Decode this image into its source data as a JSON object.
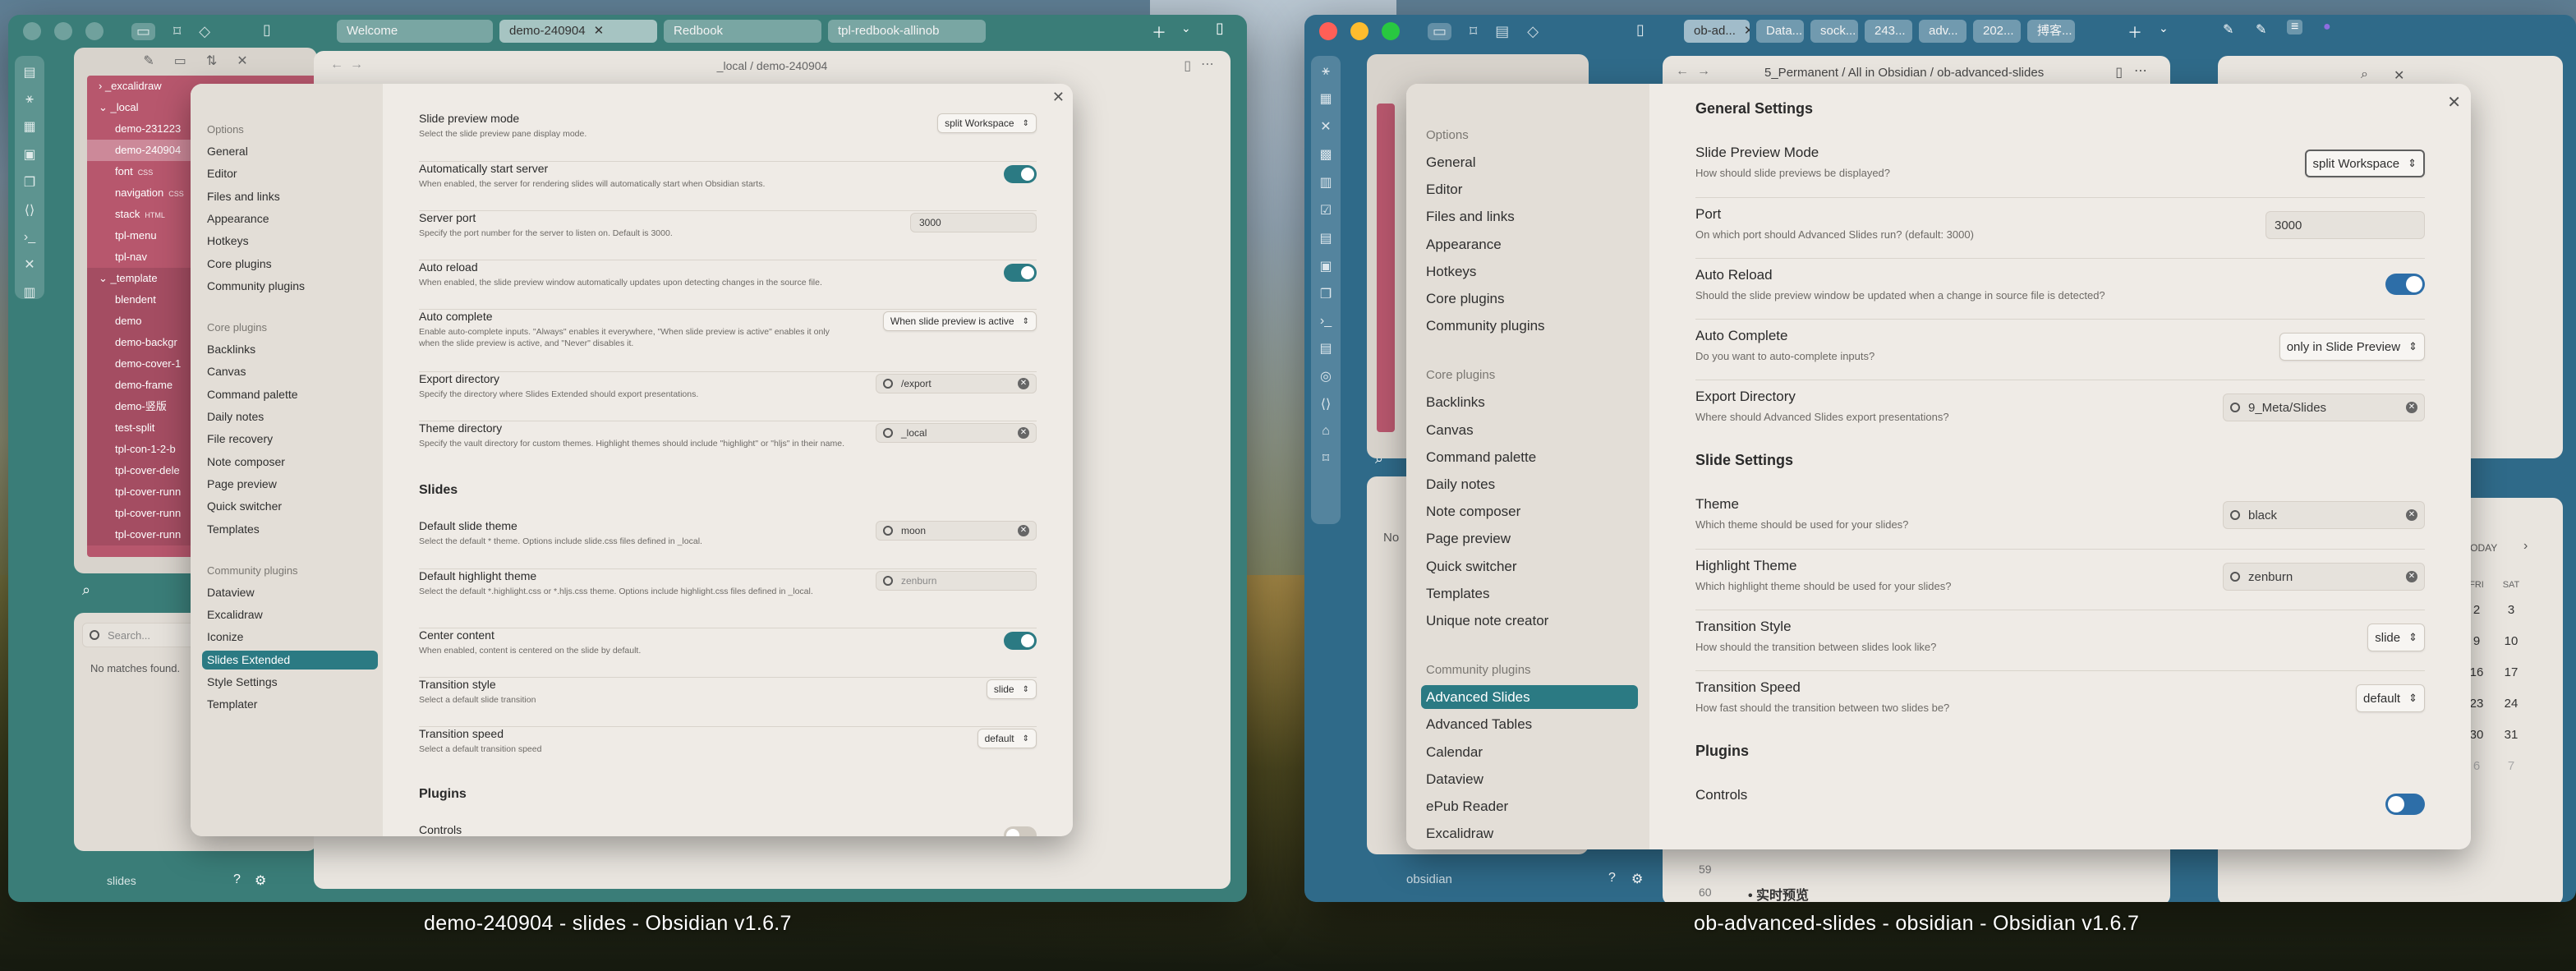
{
  "captions": {
    "left": "demo-240904 - slides - Obsidian v1.6.7",
    "right": "ob-advanced-slides - obsidian - Obsidian v1.6.7"
  },
  "left": {
    "tabs": [
      "Welcome",
      "demo-240904",
      "Redbook",
      "tpl-redbook-allinob"
    ],
    "breadcrumb": "_local / demo-240904",
    "tree": {
      "excalidraw": "_excalidraw",
      "local": "_local",
      "items_local": [
        {
          "label": "demo-231223",
          "tag": ""
        },
        {
          "label": "demo-240904",
          "tag": ""
        },
        {
          "label": "font",
          "tag": "CSS"
        },
        {
          "label": "navigation",
          "tag": "CSS"
        },
        {
          "label": "stack",
          "tag": "HTML"
        },
        {
          "label": "tpl-menu",
          "tag": ""
        },
        {
          "label": "tpl-nav",
          "tag": ""
        }
      ],
      "template": "_template",
      "items_template": [
        "blendent",
        "demo",
        "demo-backgr",
        "demo-cover-1",
        "demo-frame",
        "demo-竖版",
        "test-split",
        "tpl-con-1-2-b",
        "tpl-cover-dele",
        "tpl-cover-runn",
        "tpl-cover-runn",
        "tpl-cover-runn"
      ]
    },
    "search": {
      "placeholder": "Search...",
      "empty": "No matches found."
    },
    "vault_name": "slides",
    "settings_nav": {
      "options_title": "Options",
      "options": [
        "General",
        "Editor",
        "Files and links",
        "Appearance",
        "Hotkeys",
        "Core plugins",
        "Community plugins"
      ],
      "core_title": "Core plugins",
      "core": [
        "Backlinks",
        "Canvas",
        "Command palette",
        "Daily notes",
        "File recovery",
        "Note composer",
        "Page preview",
        "Quick switcher",
        "Templates"
      ],
      "community_title": "Community plugins",
      "community": [
        "Dataview",
        "Excalidraw",
        "Iconize",
        "Slides Extended",
        "Style Settings",
        "Templater"
      ],
      "selected": "Slides Extended"
    },
    "settings": [
      {
        "name": "Slide preview mode",
        "desc": "Select the slide preview pane display mode.",
        "control": "dropdown",
        "value": "split Workspace"
      },
      {
        "name": "Automatically start server",
        "desc": "When enabled, the server for rendering slides will automatically start when Obsidian starts.",
        "control": "toggle",
        "value": "on"
      },
      {
        "name": "Server port",
        "desc": "Specify the port number for the server to listen on. Default is 3000.",
        "control": "field",
        "value": "3000"
      },
      {
        "name": "Auto reload",
        "desc": "When enabled, the slide preview window automatically updates upon detecting changes in the source file.",
        "control": "toggle",
        "value": "on"
      },
      {
        "name": "Auto complete",
        "desc": "Enable auto-complete inputs. \"Always\" enables it everywhere, \"When slide preview is active\" enables it only when the slide preview is active, and \"Never\" disables it.",
        "control": "dropdown",
        "value": "When slide preview is active"
      },
      {
        "name": "Export directory",
        "desc": "Specify the directory where Slides Extended should export presentations.",
        "control": "search",
        "value": "/export"
      },
      {
        "name": "Theme directory",
        "desc": "Specify the vault directory for custom themes. Highlight themes should include \"highlight\" or \"hljs\" in their name.",
        "control": "search",
        "value": "_local"
      }
    ],
    "slides_heading": "Slides",
    "slides": [
      {
        "name": "Default slide theme",
        "desc": "Select the default * theme. Options include slide.css files defined in _local.",
        "control": "search",
        "value": "moon"
      },
      {
        "name": "Default highlight theme",
        "desc": "Select the default *.highlight.css or *.hljs.css theme. Options include highlight.css files defined in _local.",
        "control": "search-empty",
        "value": "zenburn"
      },
      {
        "name": "Center content",
        "desc": "When enabled, content is centered on the slide by default.",
        "control": "toggle",
        "value": "on"
      },
      {
        "name": "Transition style",
        "desc": "Select a default slide transition",
        "control": "dropdown",
        "value": "slide"
      },
      {
        "name": "Transition speed",
        "desc": "Select a default transition speed",
        "control": "dropdown",
        "value": "default"
      }
    ],
    "plugins_heading": "Plugins",
    "plugins": [
      {
        "name": "Controls"
      }
    ]
  },
  "right": {
    "tabs": [
      "ob-ad...",
      "Data...",
      "sock...",
      "243...",
      "adv...",
      "202...",
      "搏客..."
    ],
    "breadcrumb": "5_Permanent / All in Obsidian / ob-advanced-slides",
    "vault_name": "obsidian",
    "search_empty": "No",
    "settings_nav": {
      "options_title": "Options",
      "options": [
        "General",
        "Editor",
        "Files and links",
        "Appearance",
        "Hotkeys",
        "Core plugins",
        "Community plugins"
      ],
      "core_title": "Core plugins",
      "core": [
        "Backlinks",
        "Canvas",
        "Command palette",
        "Daily notes",
        "Note composer",
        "Page preview",
        "Quick switcher",
        "Templates",
        "Unique note creator"
      ],
      "community_title": "Community plugins",
      "community": [
        "Advanced Slides",
        "Advanced Tables",
        "Calendar",
        "Dataview",
        "ePub Reader",
        "Excalidraw"
      ],
      "selected": "Advanced Slides"
    },
    "general_heading": "General Settings",
    "settings": [
      {
        "name": "Slide Preview Mode",
        "desc": "How should slide previews be displayed?",
        "control": "dropdown-hl",
        "value": "split Workspace"
      },
      {
        "name": "Port",
        "desc": "On which port should Advanced Slides run? (default: 3000)",
        "control": "field",
        "value": "3000"
      },
      {
        "name": "Auto Reload",
        "desc": "Should the slide preview window be updated when a change in source file is detected?",
        "control": "toggle",
        "value": "on"
      },
      {
        "name": "Auto Complete",
        "desc": "Do you want to auto-complete inputs?",
        "control": "dropdown",
        "value": "only in Slide Preview"
      },
      {
        "name": "Export Directory",
        "desc": "Where should Advanced Slides export presentations?",
        "control": "search",
        "value": "9_Meta/Slides"
      }
    ],
    "slide_heading": "Slide Settings",
    "slides": [
      {
        "name": "Theme",
        "desc": "Which theme should be used for your slides?",
        "control": "search",
        "value": "black"
      },
      {
        "name": "Highlight Theme",
        "desc": "Which highlight theme should be used for your slides?",
        "control": "search",
        "value": "zenburn"
      },
      {
        "name": "Transition Style",
        "desc": "How should the transition between slides look like?",
        "control": "dropdown",
        "value": "slide"
      },
      {
        "name": "Transition Speed",
        "desc": "How fast should the transition between two slides be?",
        "control": "dropdown",
        "value": "default"
      }
    ],
    "plugins_heading": "Plugins",
    "plugins": [
      {
        "name": "Controls"
      }
    ],
    "editor_lines": [
      {
        "num": "59",
        "text": ""
      },
      {
        "num": "60",
        "text": "• 实时预览"
      }
    ],
    "calendar": {
      "today": "TODAY",
      "days": [
        "FRI",
        "SAT"
      ],
      "rows": [
        [
          "2",
          "3"
        ],
        [
          "9",
          "10"
        ],
        [
          "16",
          "17"
        ],
        [
          "23",
          "24"
        ],
        [
          "30",
          "31"
        ],
        [
          "6",
          "7"
        ]
      ]
    }
  }
}
